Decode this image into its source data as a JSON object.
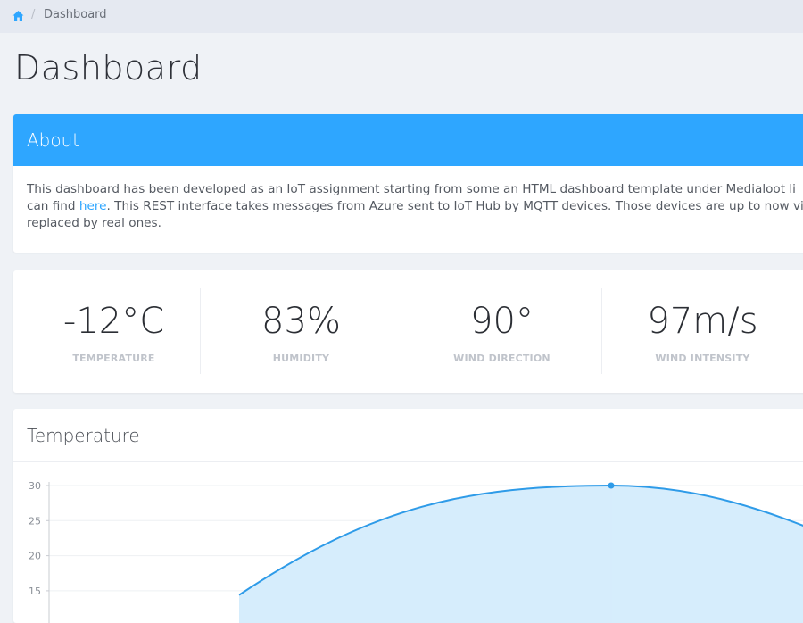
{
  "breadcrumb": {
    "separator": "/",
    "current": "Dashboard"
  },
  "page": {
    "title": "Dashboard"
  },
  "about": {
    "title": "About",
    "line1": "This dashboard has been developed as an IoT assignment starting from some an HTML dashboard template under Medialoot li",
    "line2_before": "can find ",
    "link_text": "here",
    "line2_after": ". This REST interface takes messages from Azure sent to IoT Hub by MQTT devices. Those devices are up to now virt",
    "line3": "replaced by real ones."
  },
  "stats": [
    {
      "value": "-12°C",
      "label": "TEMPERATURE"
    },
    {
      "value": "83%",
      "label": "HUMIDITY"
    },
    {
      "value": "90°",
      "label": "WIND DIRECTION"
    },
    {
      "value": "97m/s",
      "label": "WIND INTENSITY"
    }
  ],
  "chart_card": {
    "title": "Temperature"
  },
  "colors": {
    "accent": "#2ea6ff",
    "line": "#2e9be8",
    "area": "#d4ecfc"
  },
  "chart_data": {
    "type": "area",
    "title": "Temperature",
    "y_ticks": [
      "30",
      "25",
      "20",
      "15"
    ],
    "ylim": [
      15,
      30
    ],
    "visible_points": [
      {
        "index": 0,
        "y": 14.4
      },
      {
        "index": 1,
        "y": 30
      },
      {
        "index": 2,
        "y": 22.5
      }
    ],
    "grid": true
  }
}
